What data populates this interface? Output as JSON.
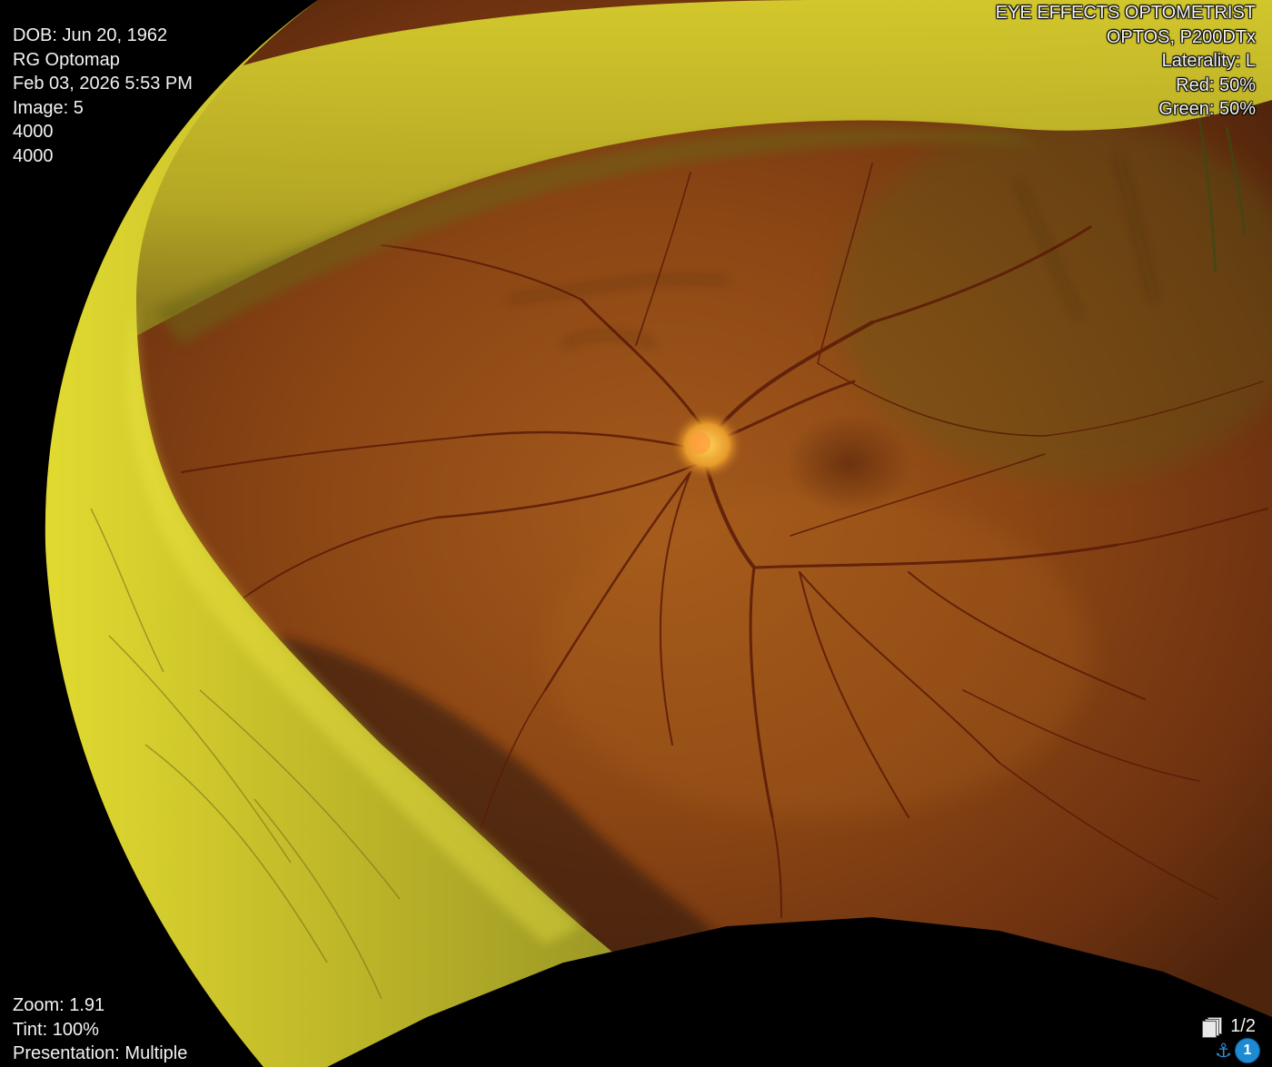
{
  "header_left": {
    "dob": "DOB: Jun 20, 1962",
    "study": "RG Optomap",
    "datetime": "Feb 03, 2026 5:53 PM",
    "image": "Image: 5",
    "width": "4000",
    "height": "4000"
  },
  "header_right": {
    "institution": "EYE EFFECTS OPTOMETRIST",
    "device": "OPTOS, P200DTx",
    "laterality": "Laterality: L",
    "red": "Red: 50%",
    "green": "Green: 50%"
  },
  "footer_left": {
    "zoom": "Zoom: 1.91",
    "tint": "Tint: 100%",
    "presentation": "Presentation: Multiple"
  },
  "footer_right": {
    "series_counter": "1/2",
    "frame_badge": "1",
    "stack_icon": "image-stack-icon",
    "anchor_icon": "anchor-icon"
  },
  "colors": {
    "fundus_base": "#8a4a14",
    "eyelid_yellow": "#c8c22a",
    "vessel": "#5a1a08",
    "badge": "#1d8ad3"
  }
}
